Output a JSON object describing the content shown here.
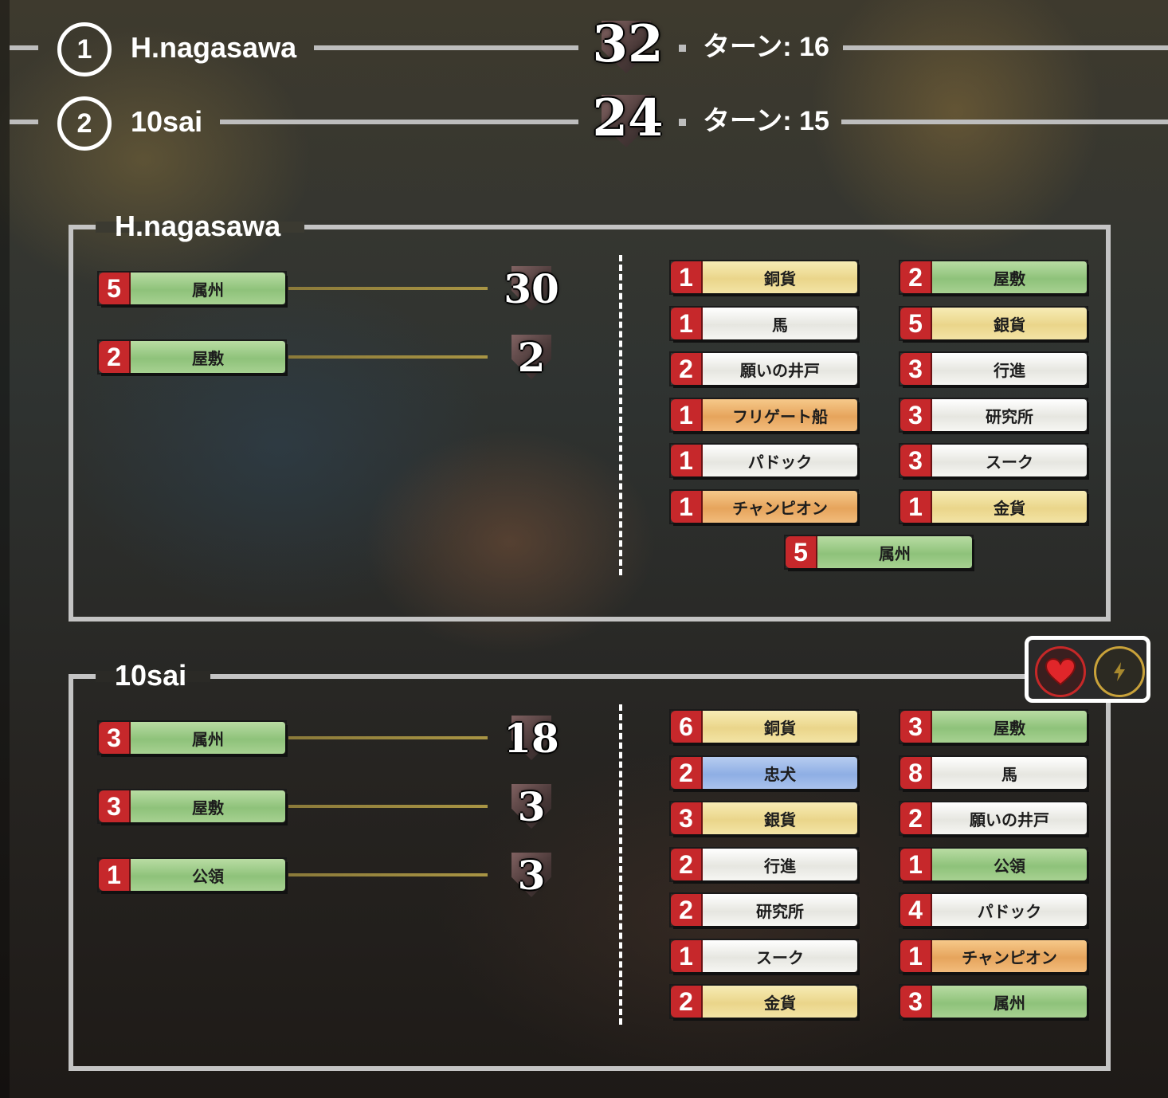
{
  "players": [
    {
      "rank": "1",
      "name": "H.nagasawa",
      "score": "32",
      "turn": "ターン: 16"
    },
    {
      "rank": "2",
      "name": "10sai",
      "score": "24",
      "turn": "ターン: 15"
    }
  ],
  "panels": [
    {
      "title": "H.nagasawa",
      "scoring": [
        {
          "count": "5",
          "label": "属州",
          "points": "30",
          "color": "green"
        },
        {
          "count": "2",
          "label": "屋敷",
          "points": "2",
          "color": "green"
        }
      ],
      "deck": [
        {
          "count": "1",
          "label": "銅貨",
          "color": "yellow"
        },
        {
          "count": "2",
          "label": "屋敷",
          "color": "green"
        },
        {
          "count": "1",
          "label": "馬",
          "color": "white"
        },
        {
          "count": "5",
          "label": "銀貨",
          "color": "yellow"
        },
        {
          "count": "2",
          "label": "願いの井戸",
          "color": "white"
        },
        {
          "count": "3",
          "label": "行進",
          "color": "white"
        },
        {
          "count": "1",
          "label": "フリゲート船",
          "color": "orange"
        },
        {
          "count": "3",
          "label": "研究所",
          "color": "white"
        },
        {
          "count": "1",
          "label": "パドック",
          "color": "white"
        },
        {
          "count": "3",
          "label": "スーク",
          "color": "white"
        },
        {
          "count": "1",
          "label": "チャンピオン",
          "color": "orange"
        },
        {
          "count": "1",
          "label": "金貨",
          "color": "yellow"
        },
        {
          "count": "5",
          "label": "属州",
          "color": "green"
        }
      ]
    },
    {
      "title": "10sai",
      "scoring": [
        {
          "count": "3",
          "label": "属州",
          "points": "18",
          "color": "green"
        },
        {
          "count": "3",
          "label": "屋敷",
          "points": "3",
          "color": "green"
        },
        {
          "count": "1",
          "label": "公領",
          "points": "3",
          "color": "green"
        }
      ],
      "deck": [
        {
          "count": "6",
          "label": "銅貨",
          "color": "yellow"
        },
        {
          "count": "3",
          "label": "屋敷",
          "color": "green"
        },
        {
          "count": "2",
          "label": "忠犬",
          "color": "blue"
        },
        {
          "count": "8",
          "label": "馬",
          "color": "white"
        },
        {
          "count": "3",
          "label": "銀貨",
          "color": "yellow"
        },
        {
          "count": "2",
          "label": "願いの井戸",
          "color": "white"
        },
        {
          "count": "2",
          "label": "行進",
          "color": "white"
        },
        {
          "count": "1",
          "label": "公領",
          "color": "green"
        },
        {
          "count": "2",
          "label": "研究所",
          "color": "white"
        },
        {
          "count": "4",
          "label": "パドック",
          "color": "white"
        },
        {
          "count": "1",
          "label": "スーク",
          "color": "white"
        },
        {
          "count": "1",
          "label": "チャンピオン",
          "color": "orange"
        },
        {
          "count": "2",
          "label": "金貨",
          "color": "yellow"
        },
        {
          "count": "3",
          "label": "属州",
          "color": "green"
        }
      ]
    }
  ],
  "icons": {
    "heart": "heart-icon",
    "bolt": "lightning-icon"
  },
  "colors": {
    "count_badge": "#c6282b",
    "frame": "#c4c4c4",
    "heart": "#c62828",
    "bolt": "#c9a23a"
  }
}
